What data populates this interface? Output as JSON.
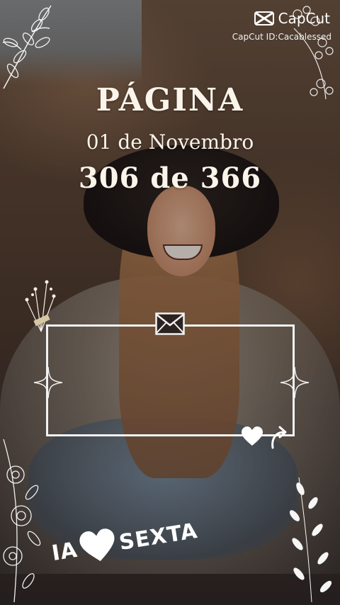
{
  "watermark": {
    "brand": "CapCut",
    "id_text": "CapCut ID:Cacablessed"
  },
  "title": {
    "page_label": "PÁGINA",
    "date": "01 de Novembro",
    "counter": "306 de 366"
  },
  "sticker": {
    "left_text": "IA",
    "right_text": "SEXTA"
  },
  "icons": {
    "envelope": "envelope-icon",
    "heart": "heart-icon",
    "share": "share-arrow-icon",
    "sparkle": "sparkle-icon",
    "logo": "capcut-logo-icon"
  },
  "colors": {
    "text": "#fbf4ea",
    "frame": "#f2f2f2"
  }
}
